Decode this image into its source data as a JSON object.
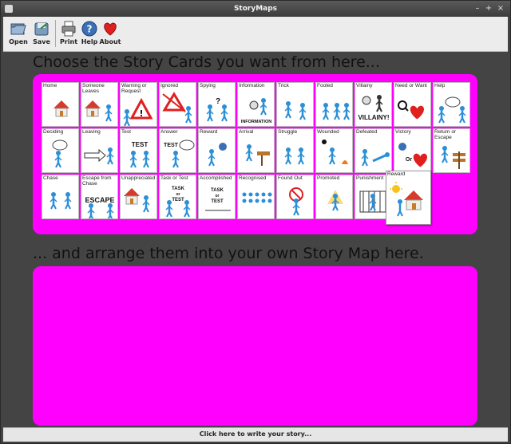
{
  "window": {
    "title": "StoryMaps"
  },
  "titlebar_buttons": {
    "minimize": "–",
    "maximize": "+",
    "close": "×"
  },
  "toolbar": {
    "open": "Open",
    "save": "Save",
    "print": "Print",
    "help": "Help",
    "about": "About"
  },
  "headings": {
    "choose": "Choose the Story Cards you want from here...",
    "arrange": "... and arrange them into your own Story Map here."
  },
  "colors": {
    "panel": "#ff00ff",
    "background": "#444444"
  },
  "cards": [
    {
      "label": "Home",
      "icon": "house-icon"
    },
    {
      "label": "Someone Leaves",
      "icon": "house-walker-icon"
    },
    {
      "label": "Warning or Request",
      "icon": "warning-icon"
    },
    {
      "label": "Ignored",
      "icon": "ignored-warning-icon"
    },
    {
      "label": "Spying",
      "icon": "spying-icon"
    },
    {
      "label": "Information",
      "icon": "information-icon",
      "text": "INFORMATION"
    },
    {
      "label": "Trick",
      "icon": "trick-icon"
    },
    {
      "label": "Fooled",
      "icon": "fooled-icon"
    },
    {
      "label": "Villainy",
      "icon": "villainy-icon",
      "text": "VILLAINY!"
    },
    {
      "label": "Need or Want",
      "icon": "need-heart-icon"
    },
    {
      "label": "Help",
      "icon": "help-icon"
    },
    {
      "label": "Deciding",
      "icon": "thinking-icon"
    },
    {
      "label": "Leaving",
      "icon": "leaving-icon"
    },
    {
      "label": "Test",
      "icon": "test-icon",
      "text": "TEST"
    },
    {
      "label": "Answer",
      "icon": "answer-icon",
      "text": "TEST"
    },
    {
      "label": "Reward",
      "icon": "reward-icon"
    },
    {
      "label": "Arrival",
      "icon": "arrival-icon"
    },
    {
      "label": "Struggle",
      "icon": "struggle-icon"
    },
    {
      "label": "Wounded",
      "icon": "wounded-icon"
    },
    {
      "label": "Defeated",
      "icon": "defeated-icon"
    },
    {
      "label": "Victory",
      "icon": "victory-icon",
      "text": "Or"
    },
    {
      "label": "Return or Escape",
      "icon": "return-icon"
    },
    {
      "label": "Chase",
      "icon": "chase-icon"
    },
    {
      "label": "Escape from Chase",
      "icon": "escape-icon",
      "text": "ESCAPE"
    },
    {
      "label": "Unappreciated",
      "icon": "unappreciated-icon"
    },
    {
      "label": "Task or Test",
      "icon": "task-icon",
      "text": "TASK or TEST"
    },
    {
      "label": "Accomplished",
      "icon": "accomplished-icon",
      "text": "TASK or TEST"
    },
    {
      "label": "Recognised",
      "icon": "recognised-icon"
    },
    {
      "label": "Found Out",
      "icon": "found-out-icon"
    },
    {
      "label": "Promoted",
      "icon": "promoted-icon"
    },
    {
      "label": "Punishment",
      "icon": "punishment-icon"
    }
  ],
  "loose_card": {
    "label": "Reward",
    "icon": "reward-home-icon"
  },
  "statusbar": {
    "label": "Click here to write your story..."
  }
}
